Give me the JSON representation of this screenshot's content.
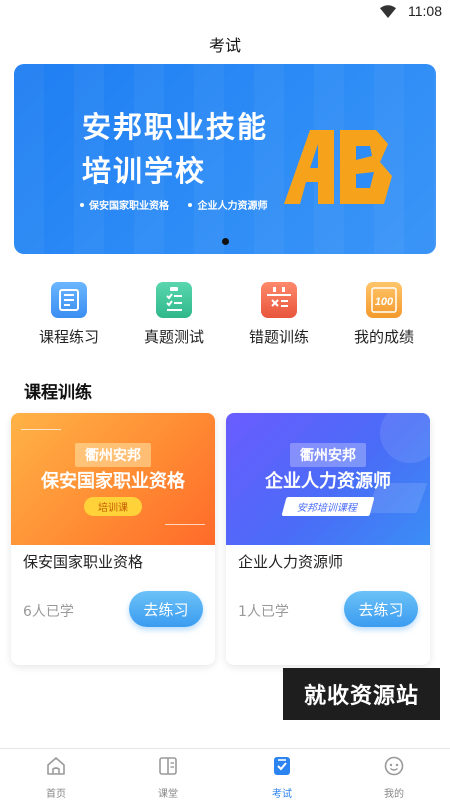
{
  "status_bar": {
    "time": "11:08"
  },
  "header": {
    "title": "考试"
  },
  "banner": {
    "title_line1": "安邦职业技能",
    "title_line2": "培训学校",
    "sub1": "保安国家职业资格",
    "sub2": "企业人力资源师",
    "logo_text": "AB",
    "active_indicator": 1
  },
  "quick_nav": [
    {
      "label": "课程练习",
      "icon": "course-practice-icon",
      "color": "#4a9cf6"
    },
    {
      "label": "真题测试",
      "icon": "clipboard-check-icon",
      "color": "#3cc49b"
    },
    {
      "label": "错题训练",
      "icon": "calendar-wrong-icon",
      "color": "#f0664a"
    },
    {
      "label": "我的成绩",
      "icon": "score-100-icon",
      "color": "#f7a234"
    }
  ],
  "section": {
    "title": "课程训练"
  },
  "courses": [
    {
      "cover_tag": "衢州安邦",
      "cover_title": "保安国家职业资格",
      "cover_badge": "培训课",
      "name": "保安国家职业资格",
      "learned": "6人已学",
      "button": "去练习"
    },
    {
      "cover_tag": "衢州安邦",
      "cover_title": "企业人力资源师",
      "cover_badge": "安邦培训课程",
      "name": "企业人力资源师",
      "learned": "1人已学",
      "button": "去练习"
    }
  ],
  "watermark": "就收资源站",
  "tabbar": [
    {
      "label": "首页",
      "icon": "home-icon"
    },
    {
      "label": "课堂",
      "icon": "book-icon"
    },
    {
      "label": "考试",
      "icon": "exam-icon",
      "active": true
    },
    {
      "label": "我的",
      "icon": "smiley-icon"
    }
  ],
  "colors": {
    "accent": "#2b84f0",
    "banner_blue": "#2d8cf6",
    "logo_orange": "#f7a21b"
  }
}
